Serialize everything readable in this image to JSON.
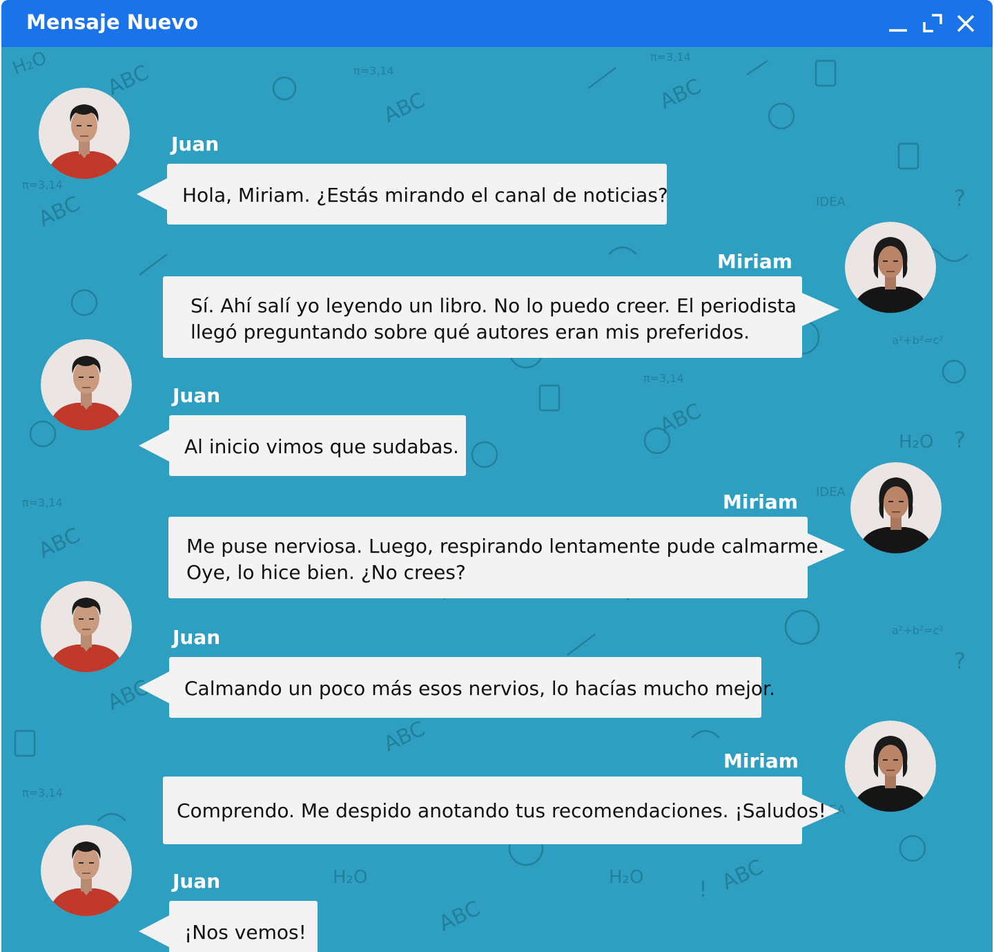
{
  "window": {
    "title": "Mensaje Nuevo",
    "controls": [
      "minimize-icon",
      "maximize-icon",
      "close-icon"
    ]
  },
  "colors": {
    "titlebar": "#1a73e8",
    "background": "#2e9fc1",
    "bubble": "#f3f3f3",
    "juan_shirt": "#c0392b",
    "miriam_shirt": "#111111"
  },
  "messages": [
    {
      "sender": "Juan",
      "lines": [
        "Hola, Miriam. ¿Estás mirando el canal de noticias?"
      ]
    },
    {
      "sender": "Miriam",
      "lines": [
        "Sí. Ahí salí yo leyendo un libro. No lo puedo creer. El periodista",
        "llegó preguntando sobre qué autores eran mis preferidos."
      ]
    },
    {
      "sender": "Juan",
      "lines": [
        "Al inicio vimos que sudabas."
      ]
    },
    {
      "sender": "Miriam",
      "lines": [
        "Me puse nerviosa. Luego, respirando lentamente pude calmarme.",
        "Oye, lo hice bien. ¿No crees?"
      ]
    },
    {
      "sender": "Juan",
      "lines": [
        "Calmando un poco más esos nervios, lo hacías mucho mejor."
      ]
    },
    {
      "sender": "Miriam",
      "lines": [
        "Comprendo. Me despido anotando tus recomendaciones. ¡Saludos!"
      ]
    },
    {
      "sender": "Juan",
      "lines": [
        "¡Nos vemos!"
      ]
    }
  ]
}
